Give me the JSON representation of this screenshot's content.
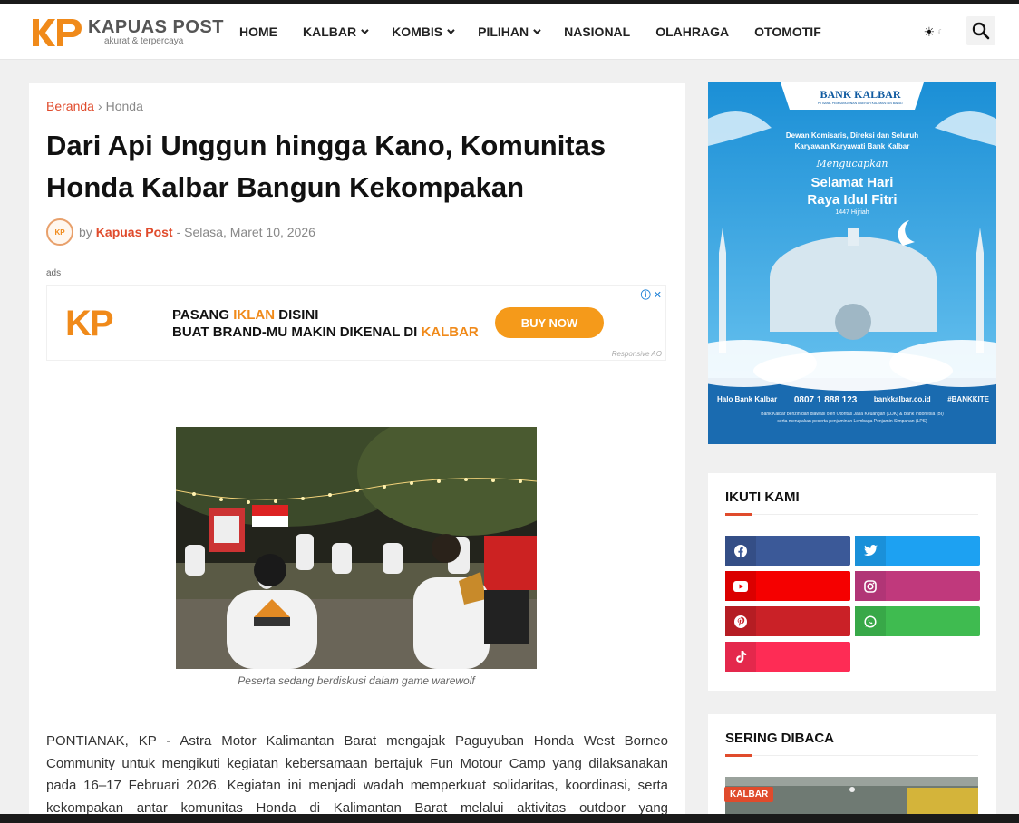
{
  "brand": {
    "name": "KAPUAS POST",
    "tagline": "akurat & terpercaya",
    "logo_mark": "KP",
    "accent": "#e04b2c",
    "logo_orange": "#f08a1a"
  },
  "nav": [
    {
      "label": "HOME",
      "has_dropdown": false
    },
    {
      "label": "KALBAR",
      "has_dropdown": true
    },
    {
      "label": "KOMBIS",
      "has_dropdown": true
    },
    {
      "label": "PILIHAN",
      "has_dropdown": true
    },
    {
      "label": "NASIONAL",
      "has_dropdown": false
    },
    {
      "label": "OLAHRAGA",
      "has_dropdown": false
    },
    {
      "label": "OTOMOTIF",
      "has_dropdown": false
    }
  ],
  "header_icons": {
    "theme": "sun-icon",
    "search": "search-icon"
  },
  "article": {
    "breadcrumb": {
      "home": "Beranda",
      "current": "Honda"
    },
    "title": "Dari Api Unggun hingga Kano, Komunitas Honda Kalbar Bangun Kekompakan",
    "author_prefix": "by",
    "author": "Kapuas Post",
    "date": "- Selasa, Maret 10, 2026",
    "ads_label": "ads",
    "ad": {
      "logo": "KP",
      "line1_a": "PASANG ",
      "line1_hl": "IKLAN",
      "line1_b": " DISINI",
      "line2_a": "BUAT BRAND-MU MAKIN DIKENAL DI ",
      "line2_hl": "KALBAR",
      "button": "BUY NOW",
      "footer": "Responsive AO"
    },
    "image_caption": "Peserta sedang berdiskusi dalam game warewolf",
    "body": "PONTIANAK, KP - Astra Motor Kalimantan Barat mengajak Paguyuban Honda West Borneo Community untuk mengikuti kegiatan kebersamaan bertajuk Fun Motour Camp yang dilaksanakan pada 16–17 Februari 2026. Kegiatan ini menjadi wadah memperkuat solidaritas, koordinasi, serta kekompakan antar komunitas Honda di Kalimantan Barat melalui aktivitas outdoor yang menyenangkan"
  },
  "sidebar_ad": {
    "bank": "BANK KALBAR",
    "bank_sub": "PT BANK PEMBANGUNAN DAERAH KALIMANTAN BARAT",
    "greeting_line1": "Dewan Komisaris, Direksi dan Seluruh",
    "greeting_line2": "Karyawan/Karyawati Bank Kalbar",
    "script": "Mengucapkan",
    "headline1": "Selamat Hari",
    "headline2": "Raya Idul Fitri",
    "hijri": "1447 Hijriah",
    "contact": "Halo Bank Kalbar",
    "phone": "0807 1 888 123",
    "site": "bankkalbar.co.id",
    "hashtag": "#BANKKITE",
    "disclaimer1": "Bank Kalbar berizin dan diawasi oleh Otoritas Jasa Keuangan (OJK) & Bank Indonesia (BI)",
    "disclaimer2": "serta merupakan peserta penjaminan Lembaga Penjamin Simpanan (LPS)"
  },
  "follow": {
    "title": "IKUTI KAMI",
    "networks": [
      {
        "name": "facebook",
        "icon": "facebook-icon",
        "color": "#3b5998",
        "icon_bg": "#344e86"
      },
      {
        "name": "twitter",
        "icon": "twitter-icon",
        "color": "#1da1f2",
        "icon_bg": "#1a90d9"
      },
      {
        "name": "youtube",
        "icon": "youtube-icon",
        "color": "#f50000",
        "icon_bg": "#db0000"
      },
      {
        "name": "instagram",
        "icon": "instagram-icon",
        "color": "#c0397c",
        "icon_bg": "#b13576"
      },
      {
        "name": "pinterest",
        "icon": "pinterest-icon",
        "color": "#ca2127",
        "icon_bg": "#b51d23"
      },
      {
        "name": "whatsapp",
        "icon": "whatsapp-icon",
        "color": "#3fbb50",
        "icon_bg": "#38a848"
      },
      {
        "name": "tiktok",
        "icon": "tiktok-icon",
        "color": "#fe2c55",
        "icon_bg": "#e4284c"
      }
    ]
  },
  "popular": {
    "title": "SERING DIBACA",
    "first_tag": "KALBAR"
  }
}
